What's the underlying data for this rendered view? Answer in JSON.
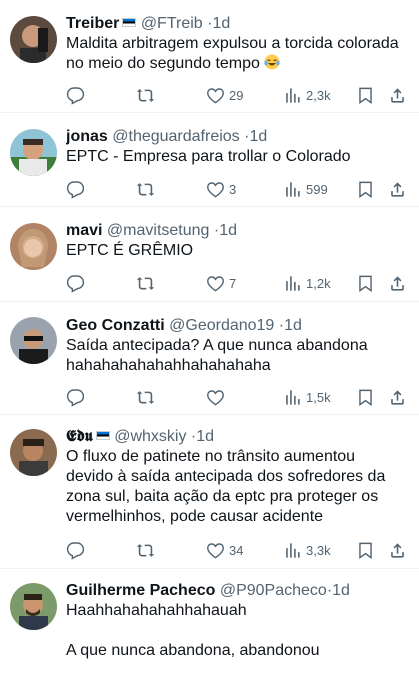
{
  "tweets": [
    {
      "name": "Treiber",
      "handle": "@FTreib",
      "dot": "·",
      "time": "1d",
      "lines": [
        "Maldita arbitragem expulsou a torcida colorada",
        "no meio do segundo tempo"
      ],
      "emoji": "laughing-crying-emoji",
      "likes": "29",
      "views": "2,3k"
    },
    {
      "name": "jonas",
      "handle": "@theguardafreios",
      "dot": "·",
      "time": "1d",
      "lines": [
        "EPTC - Empresa para trollar o Colorado"
      ],
      "likes": "3",
      "views": "599"
    },
    {
      "name": "mavi",
      "handle": "@mavitsetung",
      "dot": "·",
      "time": "1d",
      "lines": [
        "EPTC É GRÊMIO"
      ],
      "likes": "7",
      "views": "1,2k"
    },
    {
      "name": "Geo Conzatti",
      "handle": "@Geordano19",
      "dot": "·",
      "time": "1d",
      "lines": [
        "Saída antecipada? A que nunca abandona",
        "hahahahahahahhahahahaha"
      ],
      "likes": "",
      "views": "1,5k"
    },
    {
      "name": "𝕰𝖉𝖚",
      "handle": "@whxskiy",
      "dot": "·",
      "time": "1d",
      "lines": [
        "O fluxo de patinete no trânsito aumentou",
        "devido à saída antecipada dos sofredores da",
        "zona sul, baita ação da eptc pra proteger os",
        "vermelhinhos, pode causar acidente"
      ],
      "likes": "34",
      "views": "3,3k"
    },
    {
      "name": "Guilherme Pacheco",
      "handle": "@P90Pacheco",
      "dot": "·",
      "time": "1d",
      "lines": [
        "Haahhahahahahhahauah"
      ],
      "lines2": [
        "A que nunca abandona, abandonou"
      ]
    }
  ],
  "colors": {
    "text": "#0f1419",
    "secondary": "#536471",
    "divider": "#eff3f4",
    "flag_blue": "#0072ce"
  }
}
